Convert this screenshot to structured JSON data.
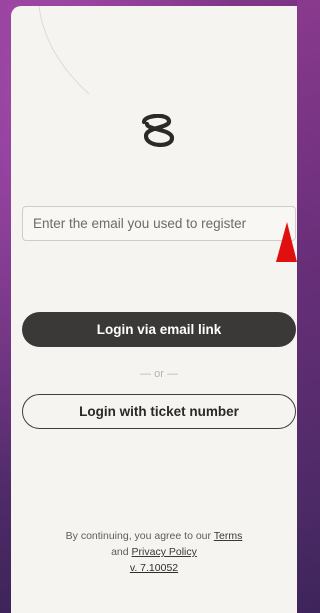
{
  "login": {
    "email_placeholder": "Enter the email you used to register",
    "email_value": "",
    "primary_button": "Login via email link",
    "or_text": "— or —",
    "secondary_button": "Login with ticket number"
  },
  "footer": {
    "prefix": "By continuing, you agree to our",
    "terms_link": "Terms",
    "and_text": "and",
    "privacy_link": "Privacy Policy",
    "version": "v. 7.10052"
  },
  "icons": {
    "logo": "brand-logo-icon",
    "annotation": "red-arrow-icon"
  },
  "colors": {
    "background": "#6a2f7a",
    "card": "#f5f4f1",
    "primary_button": "#3a3937",
    "annotation": "#e01010"
  }
}
